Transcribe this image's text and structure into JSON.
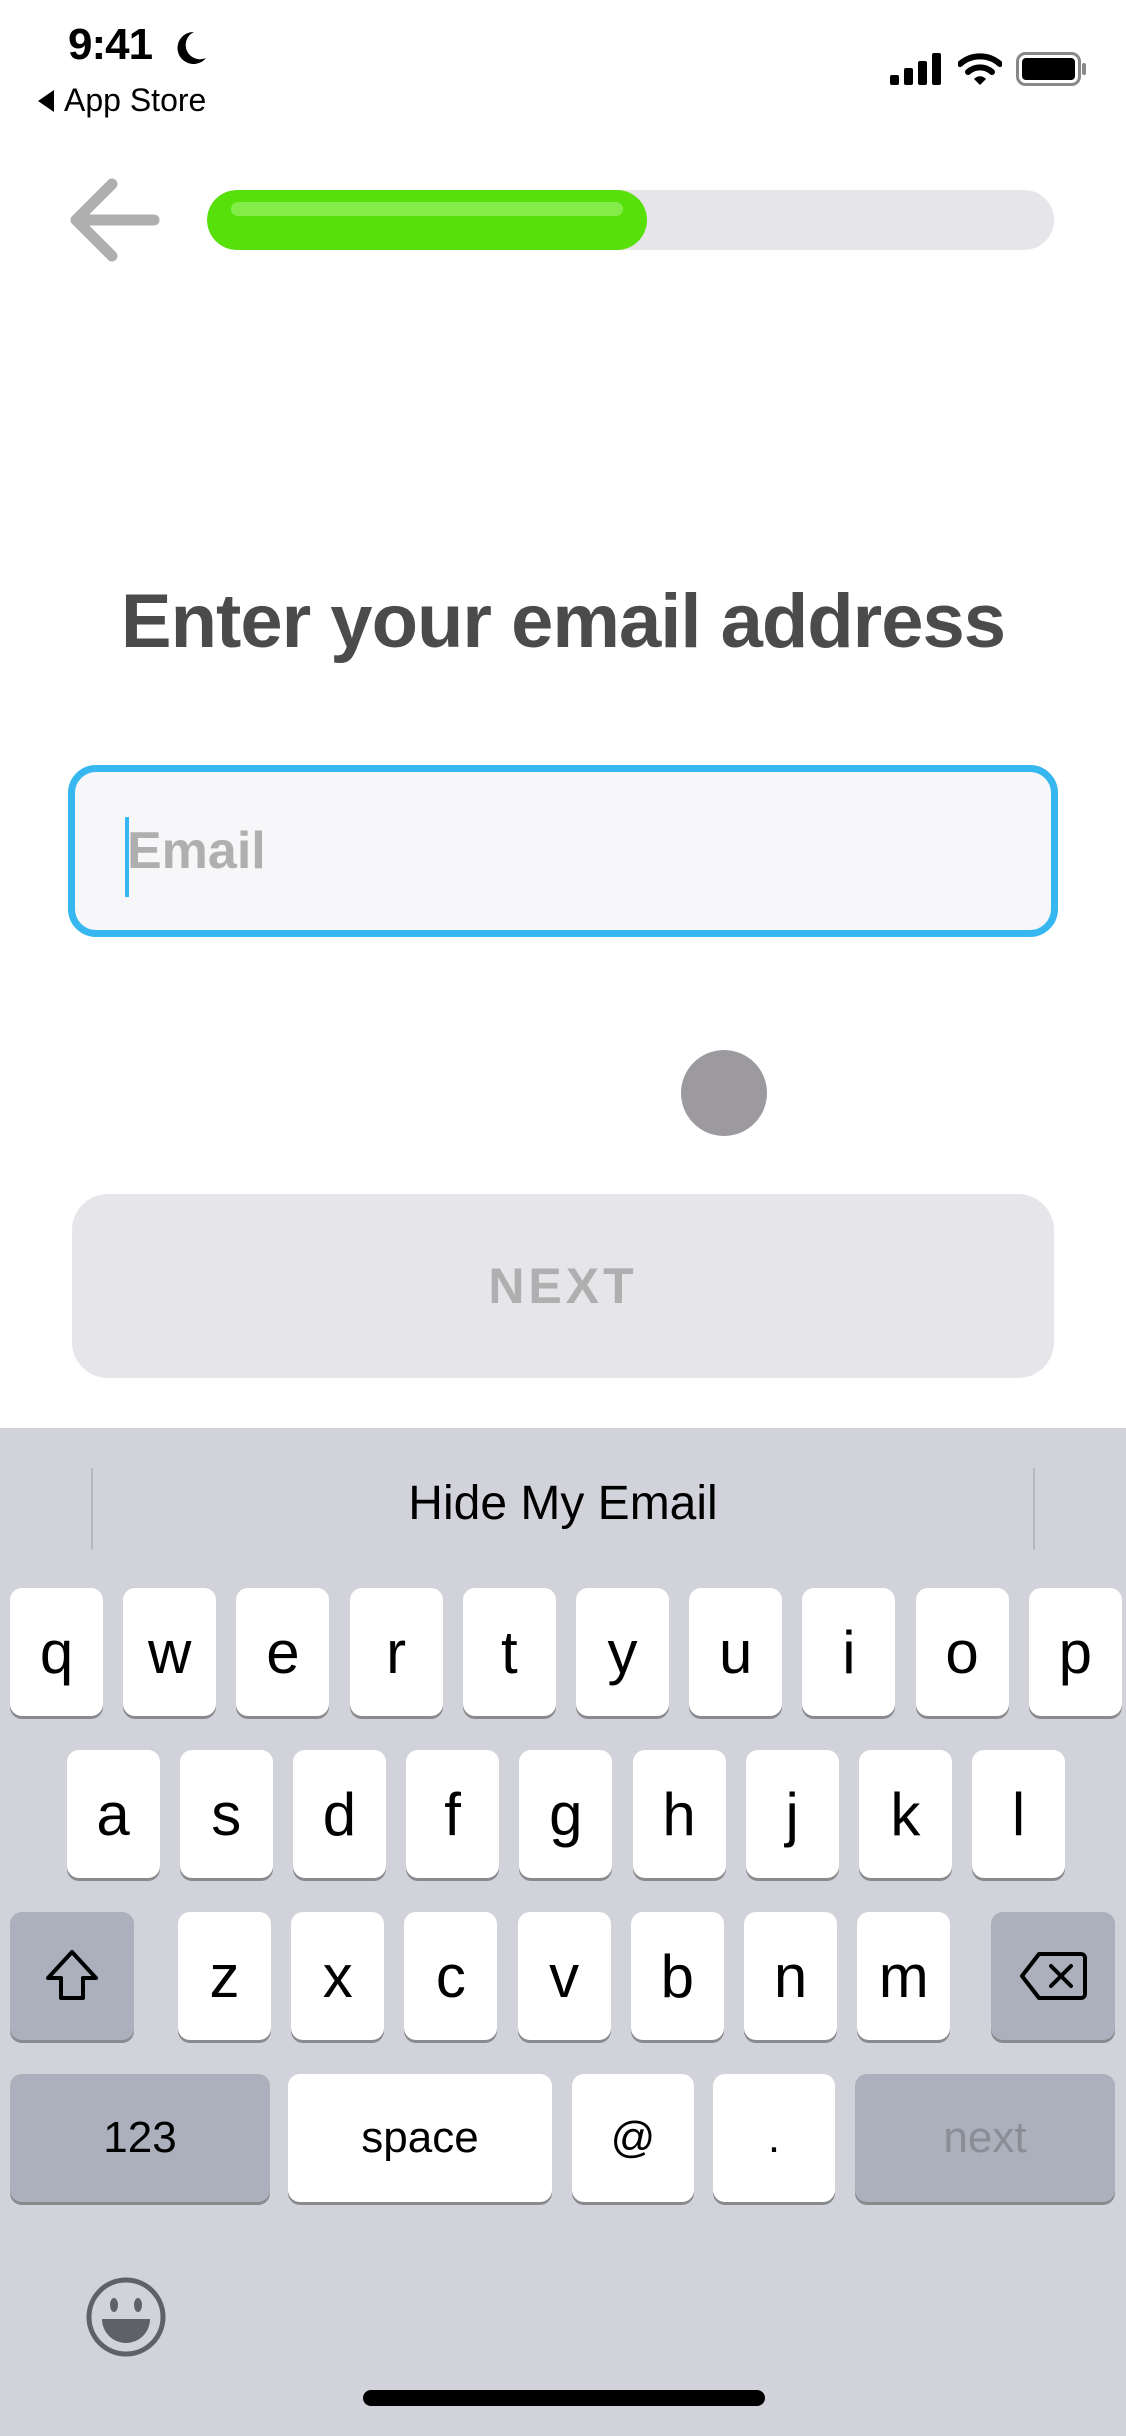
{
  "status_bar": {
    "time": "9:41",
    "focus_icon": "moon-icon",
    "back_app_label": "App Store",
    "signal_icon": "cellular-signal-icon",
    "wifi_icon": "wifi-icon",
    "battery_icon": "battery-icon"
  },
  "header": {
    "back_icon": "arrow-left-icon",
    "progress": 0.52,
    "progress_color": "#58e00a",
    "progress_track_color": "#e5e5ea"
  },
  "main": {
    "title": "Enter your email address",
    "email": {
      "value": "",
      "placeholder": "Email",
      "focused": true,
      "focus_color": "#36b7ef"
    },
    "next_button": {
      "label": "NEXT",
      "enabled": false
    }
  },
  "keyboard": {
    "suggestion": "Hide My Email",
    "rows": [
      [
        "q",
        "w",
        "e",
        "r",
        "t",
        "y",
        "u",
        "i",
        "o",
        "p"
      ],
      [
        "a",
        "s",
        "d",
        "f",
        "g",
        "h",
        "j",
        "k",
        "l"
      ],
      [
        "z",
        "x",
        "c",
        "v",
        "b",
        "n",
        "m"
      ]
    ],
    "shift_icon": "shift-icon",
    "delete_icon": "delete-backspace-icon",
    "numbers_label": "123",
    "space_label": "space",
    "at_label": "@",
    "dot_label": ".",
    "return_label": "next",
    "emoji_icon": "emoji-smile-icon"
  }
}
